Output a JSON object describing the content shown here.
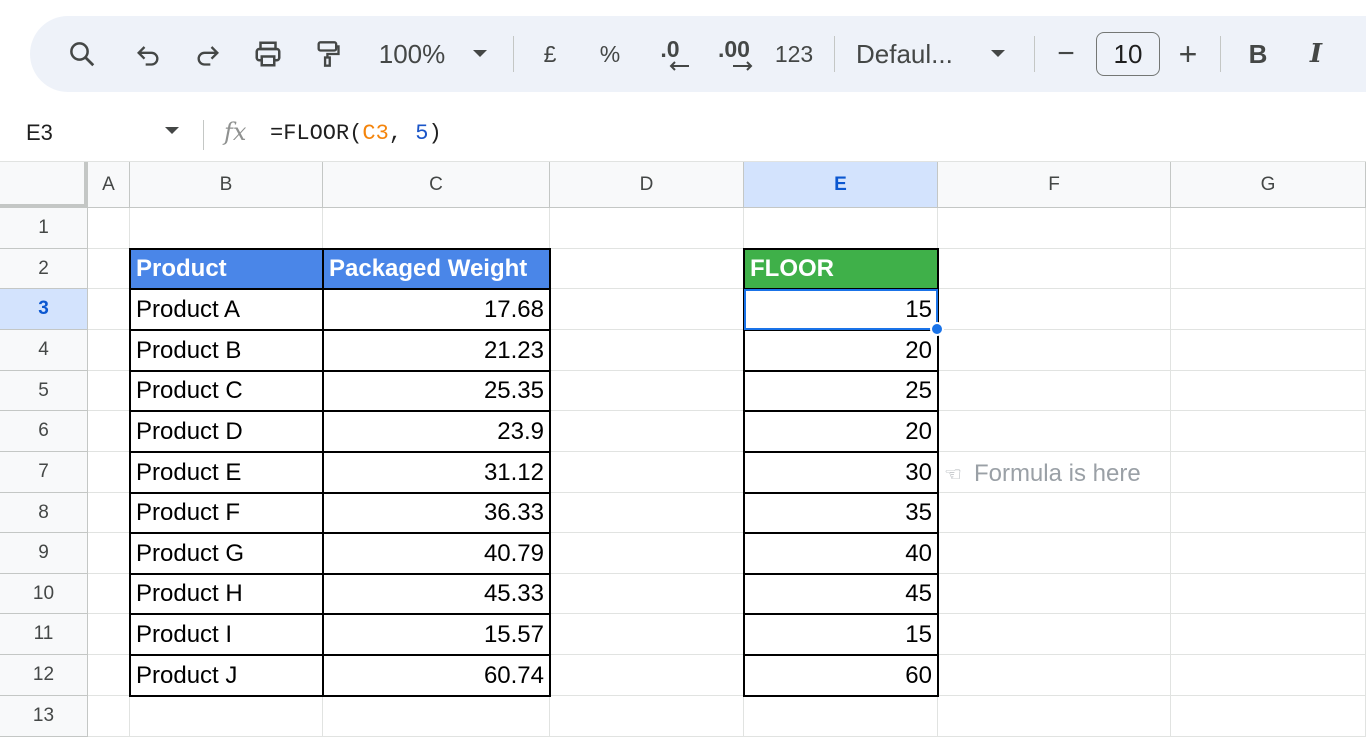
{
  "toolbar": {
    "zoom": "100%",
    "currency": "£",
    "percent": "%",
    "decrease_decimal": ".0",
    "increase_decimal": ".00",
    "number_format": "123",
    "font": "Defaul...",
    "font_size": "10",
    "minus": "−",
    "plus": "+",
    "bold": "B",
    "italic": "I"
  },
  "formula_bar": {
    "name_box": "E3",
    "fx": "fx",
    "formula_prefix": "=FLOOR(",
    "formula_ref": "C3",
    "formula_sep": ", ",
    "formula_num": "5",
    "formula_suffix": ")"
  },
  "columns": [
    "A",
    "B",
    "C",
    "D",
    "E",
    "F",
    "G"
  ],
  "rows": [
    "1",
    "2",
    "3",
    "4",
    "5",
    "6",
    "7",
    "8",
    "9",
    "10",
    "11",
    "12",
    "13"
  ],
  "selected": {
    "column": "E",
    "row": "3"
  },
  "table": {
    "header_product": "Product",
    "header_weight": "Packaged Weight",
    "header_floor": "FLOOR",
    "products": [
      "Product A",
      "Product B",
      "Product C",
      "Product D",
      "Product E",
      "Product F",
      "Product G",
      "Product H",
      "Product I",
      "Product J"
    ],
    "weights": [
      "17.68",
      "21.23",
      "25.35",
      "23.9",
      "31.12",
      "36.33",
      "40.79",
      "45.33",
      "15.57",
      "60.74"
    ],
    "floors": [
      "15",
      "20",
      "25",
      "20",
      "30",
      "35",
      "40",
      "45",
      "15",
      "60"
    ]
  },
  "annotation": {
    "icon": "pointing-left-hand-icon",
    "text": "Formula is here"
  },
  "colors": {
    "header_blue": "#4a86e8",
    "header_green": "#3fb049",
    "selection": "#1a73e8",
    "formula_ref": "#f4840b",
    "formula_num": "#1a55c8"
  }
}
